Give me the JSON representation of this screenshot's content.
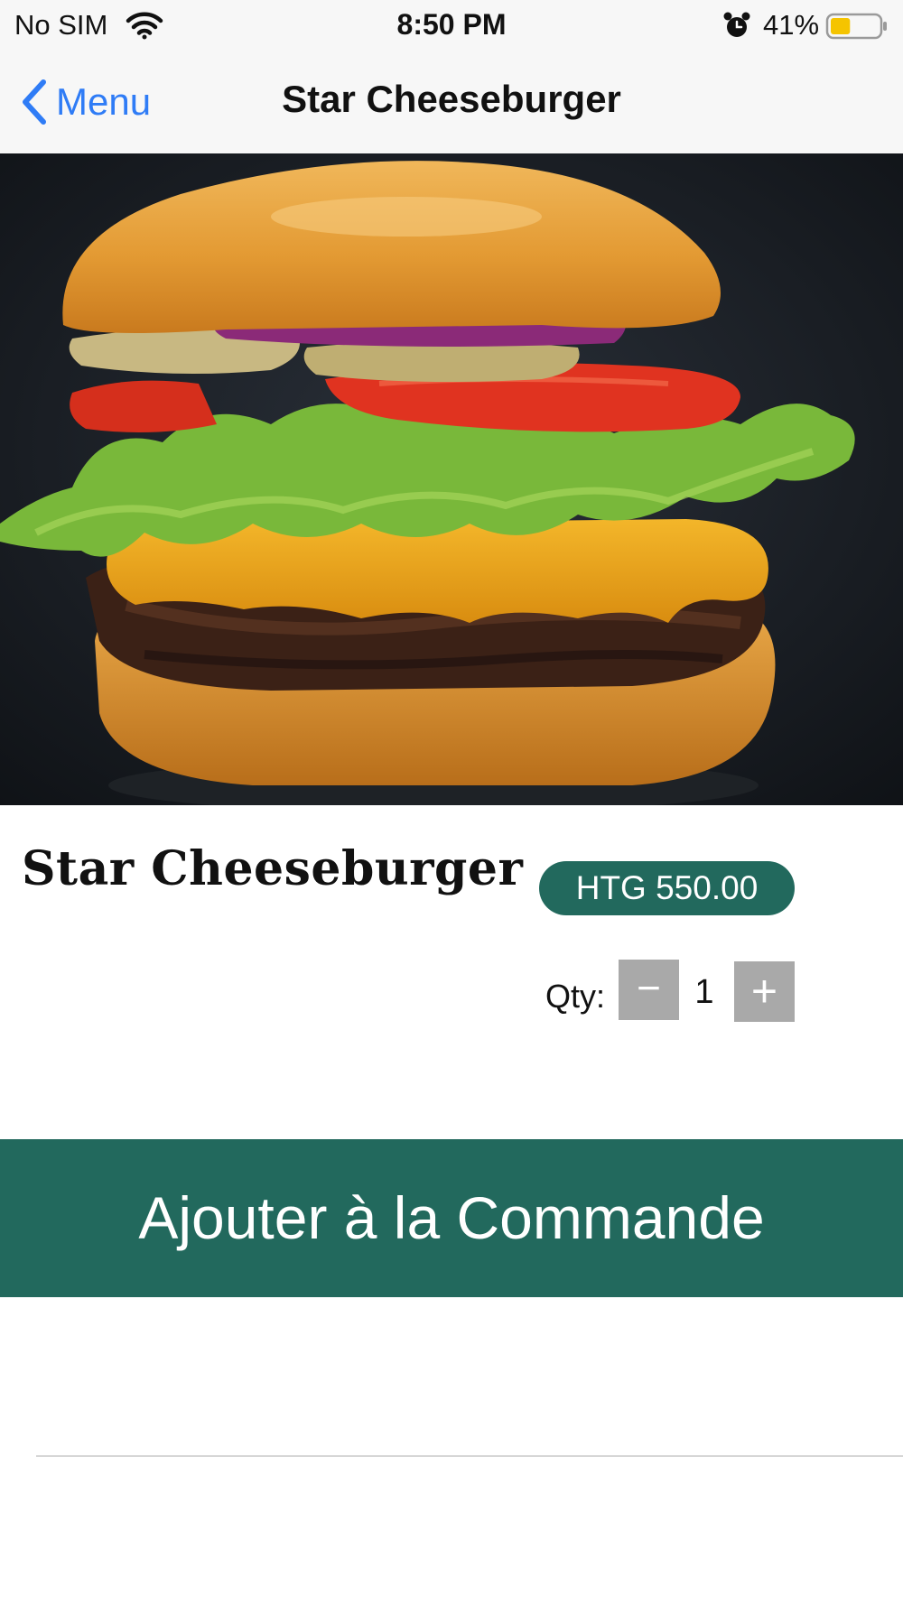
{
  "status_bar": {
    "carrier": "No SIM",
    "time": "8:50 PM",
    "battery_percent": "41%",
    "battery_level": 0.41,
    "icons": [
      "wifi-icon",
      "alarm-icon",
      "battery-icon"
    ]
  },
  "nav": {
    "back_label": "Menu",
    "title": "Star Cheeseburger",
    "accent_color": "#2f7cf6"
  },
  "product": {
    "image_icon": "cheeseburger-photo",
    "name": "Star Cheeseburger",
    "price": "HTG 550.00",
    "qty_label": "Qty:",
    "qty_minus": "−",
    "qty_value": "1",
    "qty_plus": "+"
  },
  "actions": {
    "add_to_order": "Ajouter à la Commande"
  },
  "colors": {
    "brand": "#22695d",
    "stepper": "#a9a9a9",
    "battery_fill": "#f5c400"
  }
}
